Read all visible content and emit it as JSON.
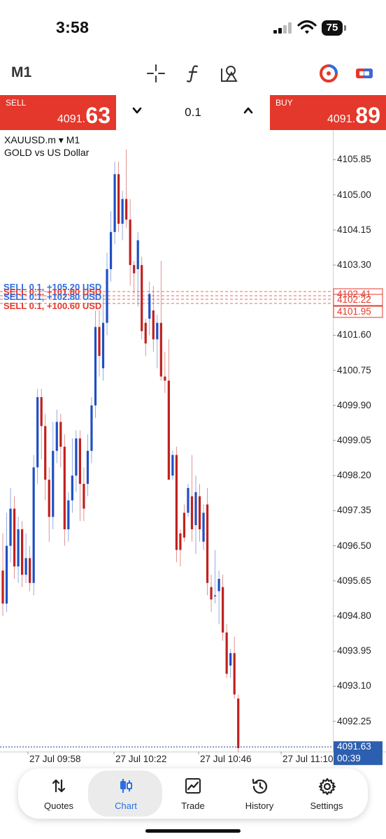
{
  "status": {
    "time": "3:58",
    "battery": "75"
  },
  "toolbar": {
    "timeframe": "M1"
  },
  "trade": {
    "sell_label": "SELL",
    "sell_price": "4091.",
    "sell_big": "63",
    "buy_label": "BUY",
    "buy_price": "4091.",
    "buy_big": "89",
    "lot": "0.1",
    "down_icon": "chevron-down-icon",
    "up_icon": "chevron-up-icon"
  },
  "chart": {
    "symbol": "XAUUSD.m ▾ M1",
    "description": "GOLD vs US Dollar",
    "current_price": "4091.63",
    "countdown": "00:39",
    "price_labels": [
      "4105.85",
      "4105.00",
      "4104.15",
      "4103.30",
      "4101.60",
      "4100.75",
      "4099.90",
      "4099.05",
      "4098.20",
      "4097.35",
      "4096.50",
      "4095.65",
      "4094.80",
      "4093.95",
      "4093.10",
      "4092.25"
    ],
    "order_labels": [
      "4102.41",
      "4102.22",
      "4101.95"
    ],
    "orders": [
      {
        "text": "SELL 0.1, +105.20 USD"
      },
      {
        "text": "SELL 0.1, +101.80 USD"
      },
      {
        "text": "SELL 0.1, +102.80 USD"
      },
      {
        "text": "SELL 0.1, +100.60 USD"
      }
    ],
    "time_labels": [
      "27 Jul 09:58",
      "27 Jul 10:22",
      "27 Jul 10:46",
      "27 Jul 11:10"
    ],
    "colors": {
      "bull": "#1f4fc4",
      "bear": "#c0201e",
      "order_line": "#e3382b"
    }
  },
  "chart_data": {
    "type": "candlestick",
    "symbol": "XAUUSD.m",
    "timeframe": "M1",
    "ylim": [
      4091.6,
      4106.4
    ],
    "time_labels": [
      "27 Jul 09:58",
      "27 Jul 10:22",
      "27 Jul 10:46",
      "27 Jul 11:10"
    ],
    "candles": [
      [
        4095.9,
        4095.1,
        4096.8,
        4094.8
      ],
      [
        4095.1,
        4096.5,
        4097.3,
        4094.9
      ],
      [
        4096.5,
        4097.4,
        4097.9,
        4096.1
      ],
      [
        4097.4,
        4096.0,
        4097.7,
        4095.7
      ],
      [
        4096.0,
        4096.9,
        4097.2,
        4095.6
      ],
      [
        4096.9,
        4095.8,
        4097.1,
        4095.5
      ],
      [
        4095.8,
        4096.2,
        4096.8,
        4095.6
      ],
      [
        4096.2,
        4095.6,
        4096.5,
        4095.4
      ],
      [
        4095.6,
        4098.4,
        4098.7,
        4095.3
      ],
      [
        4098.4,
        4100.1,
        4100.3,
        4098.0
      ],
      [
        4100.1,
        4099.4,
        4100.3,
        4098.6
      ],
      [
        4099.4,
        4098.1,
        4099.7,
        4097.6
      ],
      [
        4098.1,
        4097.2,
        4098.4,
        4096.6
      ],
      [
        4097.2,
        4098.8,
        4099.5,
        4096.9
      ],
      [
        4098.8,
        4099.5,
        4099.8,
        4098.5
      ],
      [
        4099.5,
        4098.9,
        4099.7,
        4098.4
      ],
      [
        4098.9,
        4096.9,
        4099.2,
        4096.5
      ],
      [
        4096.9,
        4097.6,
        4097.8,
        4096.6
      ],
      [
        4097.6,
        4098.2,
        4099.1,
        4097.3
      ],
      [
        4098.2,
        4099.1,
        4099.3,
        4097.8
      ],
      [
        4099.1,
        4098.0,
        4099.3,
        4097.1
      ],
      [
        4098.0,
        4097.4,
        4098.4,
        4097.1
      ],
      [
        4098.0,
        4098.8,
        4099.2,
        4097.7
      ],
      [
        4098.8,
        4099.9,
        4100.1,
        4098.5
      ],
      [
        4099.9,
        4101.8,
        4102.2,
        4099.6
      ],
      [
        4101.8,
        4101.1,
        4102.2,
        4100.6
      ],
      [
        4100.8,
        4101.9,
        4102.6,
        4100.5
      ],
      [
        4101.9,
        4103.2,
        4103.6,
        4101.6
      ],
      [
        4103.2,
        4104.1,
        4104.6,
        4102.9
      ],
      [
        4104.1,
        4105.5,
        4105.8,
        4103.8
      ],
      [
        4105.5,
        4104.3,
        4105.8,
        4104.1
      ],
      [
        4104.3,
        4104.9,
        4105.1,
        4103.9
      ],
      [
        4104.9,
        4104.4,
        4106.1,
        4104.2
      ],
      [
        4104.4,
        4103.3,
        4104.9,
        4102.8
      ],
      [
        4103.3,
        4103.1,
        4103.4,
        4102.6
      ],
      [
        4103.2,
        4103.9,
        4104.1,
        4102.3
      ],
      [
        4103.3,
        4101.7,
        4103.5,
        4101.5
      ],
      [
        4101.9,
        4101.4,
        4102.0,
        4101.1
      ],
      [
        4102.0,
        4102.6,
        4102.9,
        4101.6
      ],
      [
        4102.2,
        4101.5,
        4102.8,
        4101.2
      ],
      [
        4101.5,
        4101.9,
        4102.1,
        4100.8
      ],
      [
        4101.9,
        4100.6,
        4103.4,
        4100.5
      ],
      [
        4100.6,
        4100.5,
        4101.2,
        4100.2
      ],
      [
        4100.5,
        4098.1,
        4101.5,
        4098.3
      ],
      [
        4098.2,
        4098.7,
        4098.8,
        4098.1
      ],
      [
        4098.7,
        4096.4,
        4098.9,
        4096.1
      ],
      [
        4096.8,
        4096.4,
        4096.9,
        4096.0
      ],
      [
        4097.3,
        4096.7,
        4097.5,
        4096.6
      ],
      [
        4097.3,
        4097.9,
        4098.0,
        4097.2
      ],
      [
        4097.7,
        4096.9,
        4098.7,
        4096.6
      ],
      [
        4097.0,
        4097.8,
        4098.2,
        4096.3
      ],
      [
        4097.7,
        4096.9,
        4098.0,
        4096.6
      ],
      [
        4096.6,
        4097.3,
        4097.5,
        4096.4
      ],
      [
        4097.5,
        4095.6,
        4097.9,
        4095.3
      ],
      [
        4095.5,
        4095.2,
        4095.8,
        4094.9
      ],
      [
        4095.3,
        4095.3,
        4096.4,
        4095.1
      ],
      [
        4095.4,
        4095.7,
        4095.9,
        4094.6
      ],
      [
        4095.5,
        4094.4,
        4095.8,
        4094.2
      ],
      [
        4094.4,
        4093.4,
        4094.6,
        4093.3
      ],
      [
        4093.6,
        4093.9,
        4094.0,
        4093.3
      ],
      [
        4093.9,
        4092.9,
        4094.3,
        4092.8
      ],
      [
        4092.8,
        4091.6,
        4092.9,
        4091.5
      ]
    ]
  },
  "nav": {
    "items": [
      {
        "label": "Quotes",
        "icon": "quotes-arrows-icon"
      },
      {
        "label": "Chart",
        "icon": "candlestick-icon"
      },
      {
        "label": "Trade",
        "icon": "trade-chart-icon"
      },
      {
        "label": "History",
        "icon": "history-clock-icon"
      },
      {
        "label": "Settings",
        "icon": "gear-icon"
      }
    ],
    "active": "Chart",
    "active_color": "#2c6fe0"
  }
}
